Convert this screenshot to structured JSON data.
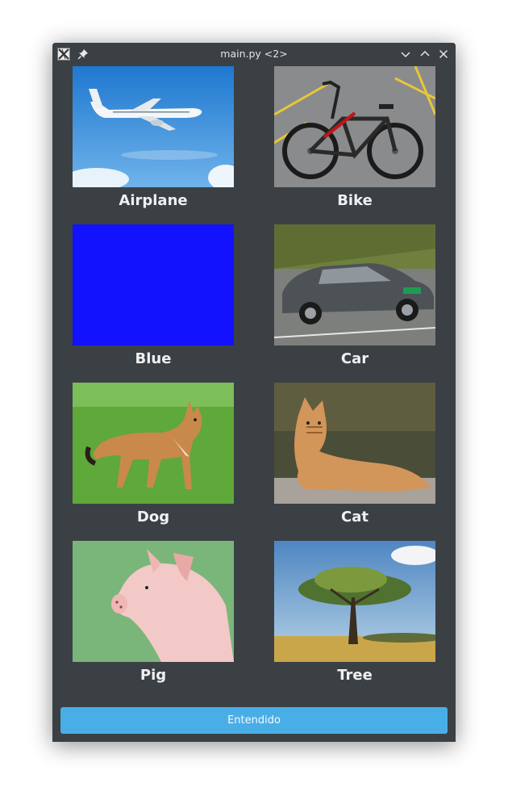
{
  "window": {
    "title": "main.py <2>"
  },
  "grid": {
    "items": [
      {
        "label": "Airplane"
      },
      {
        "label": "Bike"
      },
      {
        "label": "Blue"
      },
      {
        "label": "Car"
      },
      {
        "label": "Dog"
      },
      {
        "label": "Cat"
      },
      {
        "label": "Pig"
      },
      {
        "label": "Tree"
      }
    ]
  },
  "footer": {
    "button_label": "Entendido"
  },
  "colors": {
    "window_bg": "#3b4045",
    "accent_button": "#4aaee6",
    "blue_swatch": "#1212ff"
  }
}
